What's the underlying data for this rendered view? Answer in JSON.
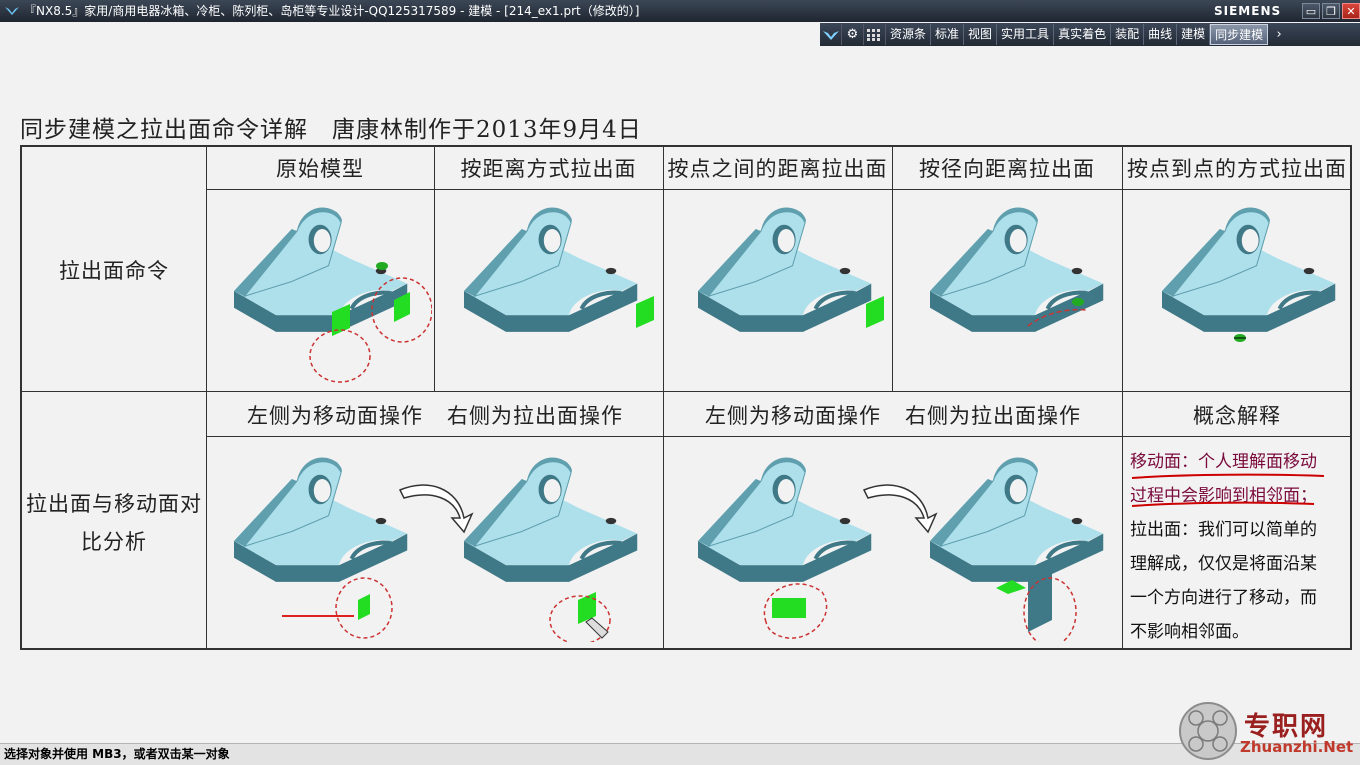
{
  "window": {
    "title": "『NX8.5』家用/商用电器冰箱、冷柜、陈列柜、岛柜等专业设计-QQ125317589 - 建模 - [214_ex1.prt（修改的）]",
    "brand": "SIEMENS",
    "btn_minimize": "▭",
    "btn_restore": "❐",
    "btn_close": "✕"
  },
  "toolbar": {
    "tabs": [
      "资源条",
      "标准",
      "视图",
      "实用工具",
      "真实着色",
      "装配",
      "曲线",
      "建模",
      "同步建模"
    ],
    "active_tab": "同步建模"
  },
  "document": {
    "title": "同步建模之拉出面命令详解　唐康林制作于2013年9月4日",
    "row1_label": "拉出面命令",
    "row2_label_line1": "拉出面与移动面对",
    "row2_label_line2": "比分析",
    "headers": [
      "原始模型",
      "按距离方式拉出面",
      "按点之间的距离拉出面",
      "按径向距离拉出面",
      "按点到点的方式拉出面"
    ],
    "compare_headers": [
      "左侧为移动面操作",
      "右侧为拉出面操作",
      "左侧为移动面操作",
      "右侧为拉出面操作",
      "概念解释"
    ],
    "explain_lines": [
      {
        "text": "移动面：个人理解面移动",
        "em": true
      },
      {
        "text": "过程中会影响到相邻面；",
        "em": true
      },
      {
        "text": "拉出面：我们可以简单的",
        "em": false
      },
      {
        "text": "理解成，仅仅是将面沿某",
        "em": false
      },
      {
        "text": "一个方向进行了移动，而",
        "em": false
      },
      {
        "text": "不影响相邻面。",
        "em": false
      }
    ]
  },
  "status": {
    "prompt": "选择对象并使用 MB3，或者双击某一对象"
  },
  "watermark": {
    "name": "专职网",
    "site": "Zhuanzhi.Net"
  },
  "colors": {
    "model_top": "#aee0ec",
    "model_side": "#5f9fae",
    "model_dark": "#3f7886",
    "highlight": "#22dd22",
    "circle": "#cc3333"
  }
}
